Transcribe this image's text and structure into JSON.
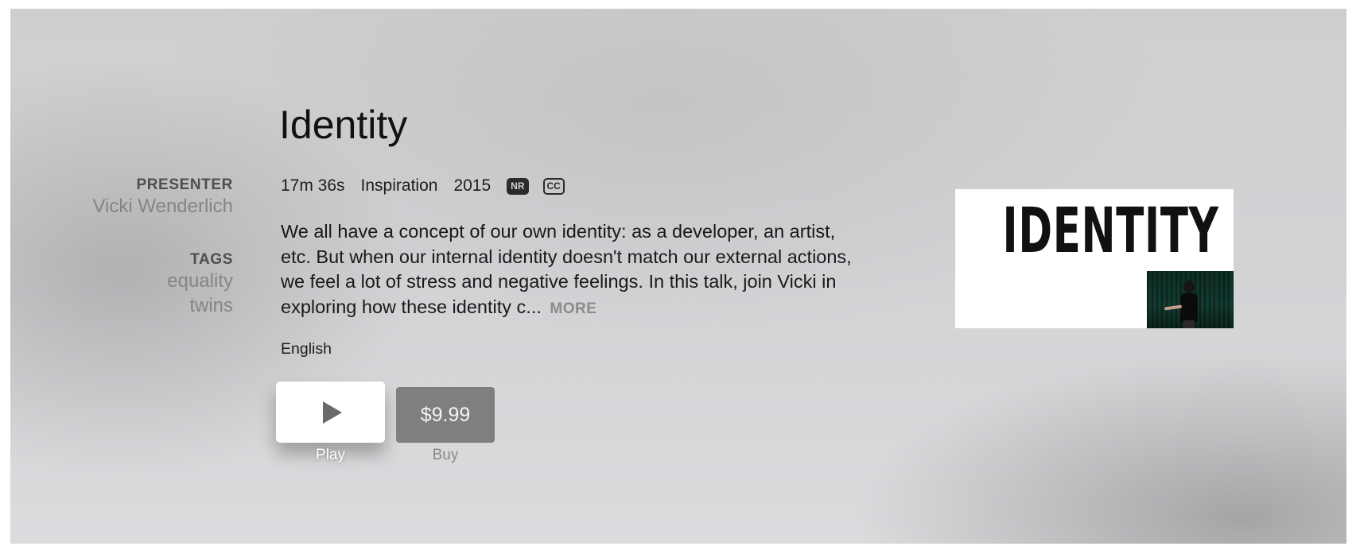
{
  "sidebar": {
    "presenter_heading": "PRESENTER",
    "presenter_name": "Vicki Wenderlich",
    "tags_heading": "TAGS",
    "tags": [
      "equality",
      "twins"
    ]
  },
  "title": "Identity",
  "meta": {
    "duration": "17m 36s",
    "genre": "Inspiration",
    "year": "2015",
    "rating_badge": "NR",
    "cc_badge": "CC"
  },
  "description": "We all have a concept of our own identity: as a developer, an artist, etc. But when our internal identity doesn't match our external actions, we feel a lot of stress and negative feelings. In this talk, join Vicki in exploring how these identity c...",
  "more_label": "MORE",
  "language": "English",
  "buttons": {
    "play_label": "Play",
    "buy_price": "$9.99",
    "buy_label": "Buy"
  },
  "thumbnail": {
    "text": "IDENTITY"
  },
  "icons": {
    "play": "play-icon"
  }
}
